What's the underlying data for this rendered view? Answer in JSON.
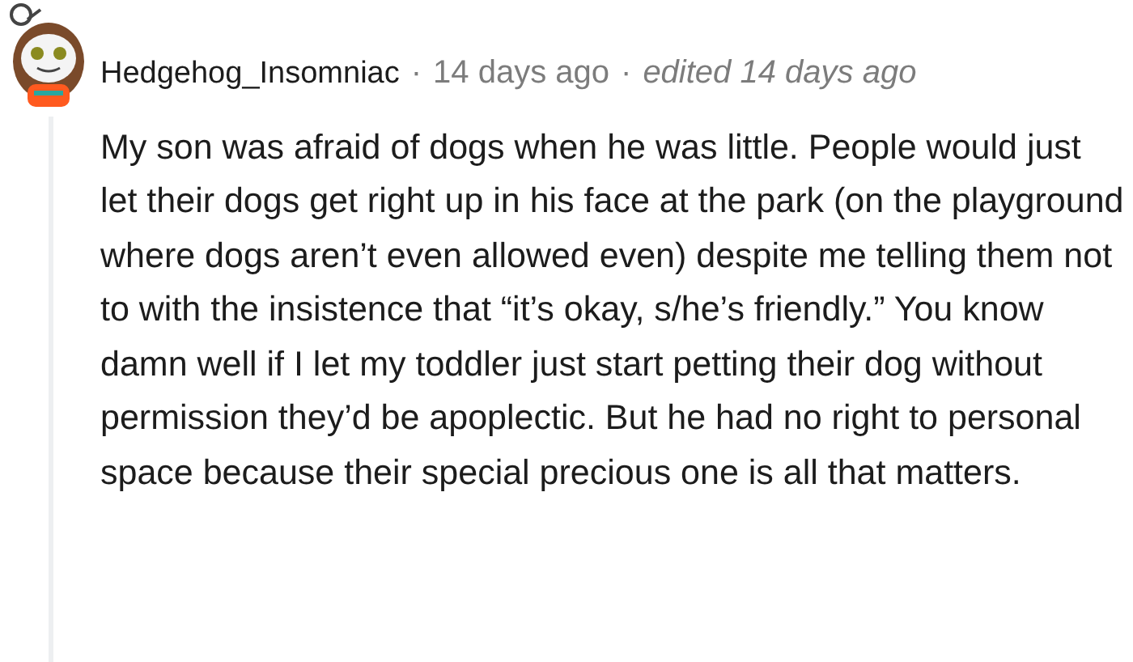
{
  "comment": {
    "author": "Hedgehog_Insomniac",
    "separator_1": "·",
    "time": "14 days ago",
    "separator_2": "·",
    "edited": "edited 14 days ago",
    "body": "My son was afraid of dogs when he was little. People would just let their dogs get right up in his face at the park (on the playground where dogs aren’t even allowed even) despite me telling them not to with the insistence that “it’s okay, s/he’s friendly.” You know damn well if I let my toddler just start petting their dog without permission they’d be apoplectic. But he had no right to personal space because their special precious one is all that matters."
  }
}
